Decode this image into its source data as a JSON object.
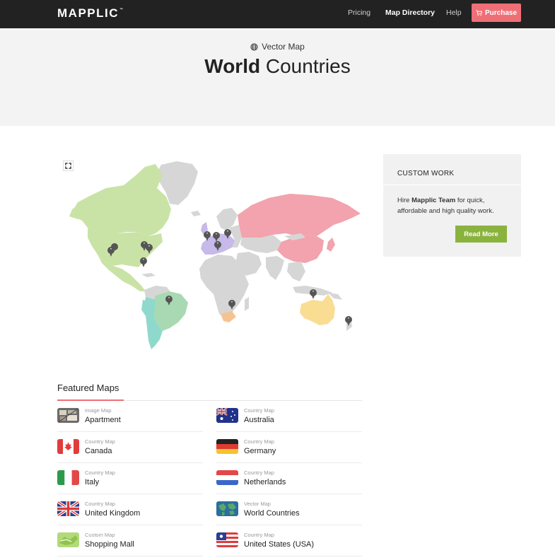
{
  "header": {
    "logo": "MAPPLIC",
    "logo_tm": "™",
    "nav": [
      {
        "label": "Pricing"
      },
      {
        "label": "Map Directory"
      },
      {
        "label": "Help"
      }
    ],
    "purchase_label": "Purchase"
  },
  "hero": {
    "subtitle": "Vector Map",
    "title_bold": "World",
    "title_light": "Countries"
  },
  "panel": {
    "title": "CUSTOM WORK",
    "text_prefix": "Hire ",
    "text_bold": "Mapplic Team",
    "text_suffix": " for quick, affordable and high quality work.",
    "button_label": "Read More"
  },
  "featured": {
    "title": "Featured Maps",
    "items": [
      {
        "type": "Image Map",
        "name": "Apartment",
        "icon": "apartment-thumb"
      },
      {
        "type": "Country Map",
        "name": "Australia",
        "icon": "australia-flag-icon"
      },
      {
        "type": "Country Map",
        "name": "Canada",
        "icon": "canada-flag-icon"
      },
      {
        "type": "Country Map",
        "name": "Germany",
        "icon": "germany-flag-icon"
      },
      {
        "type": "Country Map",
        "name": "Italy",
        "icon": "italy-flag-icon"
      },
      {
        "type": "Country Map",
        "name": "Netherlands",
        "icon": "netherlands-flag-icon"
      },
      {
        "type": "Country Map",
        "name": "United Kingdom",
        "icon": "uk-flag-icon"
      },
      {
        "type": "Vector Map",
        "name": "World Countries",
        "icon": "globe-thumb"
      },
      {
        "type": "Custom Map",
        "name": "Shopping Mall",
        "icon": "mall-thumb"
      },
      {
        "type": "Country Map",
        "name": "United States (USA)",
        "icon": "usa-flag-icon"
      }
    ]
  },
  "colors": {
    "topbar": "#222222",
    "accent": "#ef6f76",
    "green_button": "#8ab33e",
    "north_america": "#c9e3a6",
    "south_america": "#8fd9cc",
    "brazil": "#a9d9b2",
    "europe": "#c7b9ea",
    "russia_china": "#f2a3ad",
    "australia": "#f9dd92",
    "south_africa": "#f7c292",
    "other_land": "#d6d6d6",
    "pin": "#555555"
  }
}
